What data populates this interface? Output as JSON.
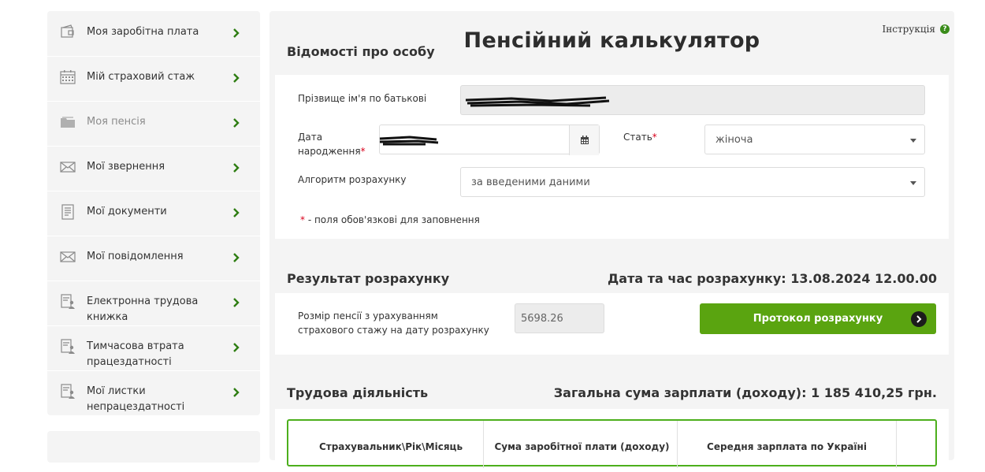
{
  "sidebar": {
    "items": [
      {
        "label": "Моя заробітна плата",
        "icon": "wallet-icon",
        "dim": false
      },
      {
        "label": "Мій страховий стаж",
        "icon": "calendar-icon",
        "dim": false
      },
      {
        "label": "Моя пенсія",
        "icon": "folder-icon",
        "dim": true
      },
      {
        "label": "Мої звернення",
        "icon": "envelope-icon",
        "dim": false
      },
      {
        "label": "Мої документи",
        "icon": "document-icon",
        "dim": false
      },
      {
        "label": "Мої повідомлення",
        "icon": "envelope-icon",
        "dim": false
      },
      {
        "label": "Електронна трудова книжка",
        "icon": "document-person-icon",
        "dim": false
      },
      {
        "label": "Тимчасова втрата працездатності",
        "icon": "document-person-icon",
        "dim": false
      },
      {
        "label": "Мої листки непрацездатності",
        "icon": "document-person-icon",
        "dim": false
      }
    ]
  },
  "header": {
    "title": "Пенсійний калькулятор",
    "instructions_label": "Інструкція"
  },
  "person": {
    "section_title": "Відомості про особу",
    "full_name_label": "Прізвище ім'я по батькові",
    "birth_date_label_line1": "Дата",
    "birth_date_label_line2": "народження",
    "gender_label": "Стать",
    "gender_value": "жіноча",
    "algorithm_label": "Алгоритм розрахунку",
    "algorithm_value": "за введеними даними",
    "required_note": " - поля обов'язкові для заповнення",
    "required_mark": "*"
  },
  "result": {
    "section_title": "Результат розрахунку",
    "datetime_label": "Дата та час розрахунку: 13.08.2024 12.00.00",
    "pension_label_line1": "Розмір пенсії з урахуванням",
    "pension_label_line2": "страхового стажу на дату розрахунку",
    "pension_value": "5698.26",
    "protocol_button": "Протокол розрахунку"
  },
  "work": {
    "section_title": "Трудова діяльність",
    "total_label": "Загальна сума зарплати (доходу): 1 185 410,25 грн.",
    "columns": [
      "Страхувальник\\Рік\\Місяць",
      "Сума заробітної плати (доходу)",
      "Середня зарплата по Україні"
    ]
  },
  "colors": {
    "accent_green": "#5aa410",
    "required_red": "#d9001b"
  }
}
